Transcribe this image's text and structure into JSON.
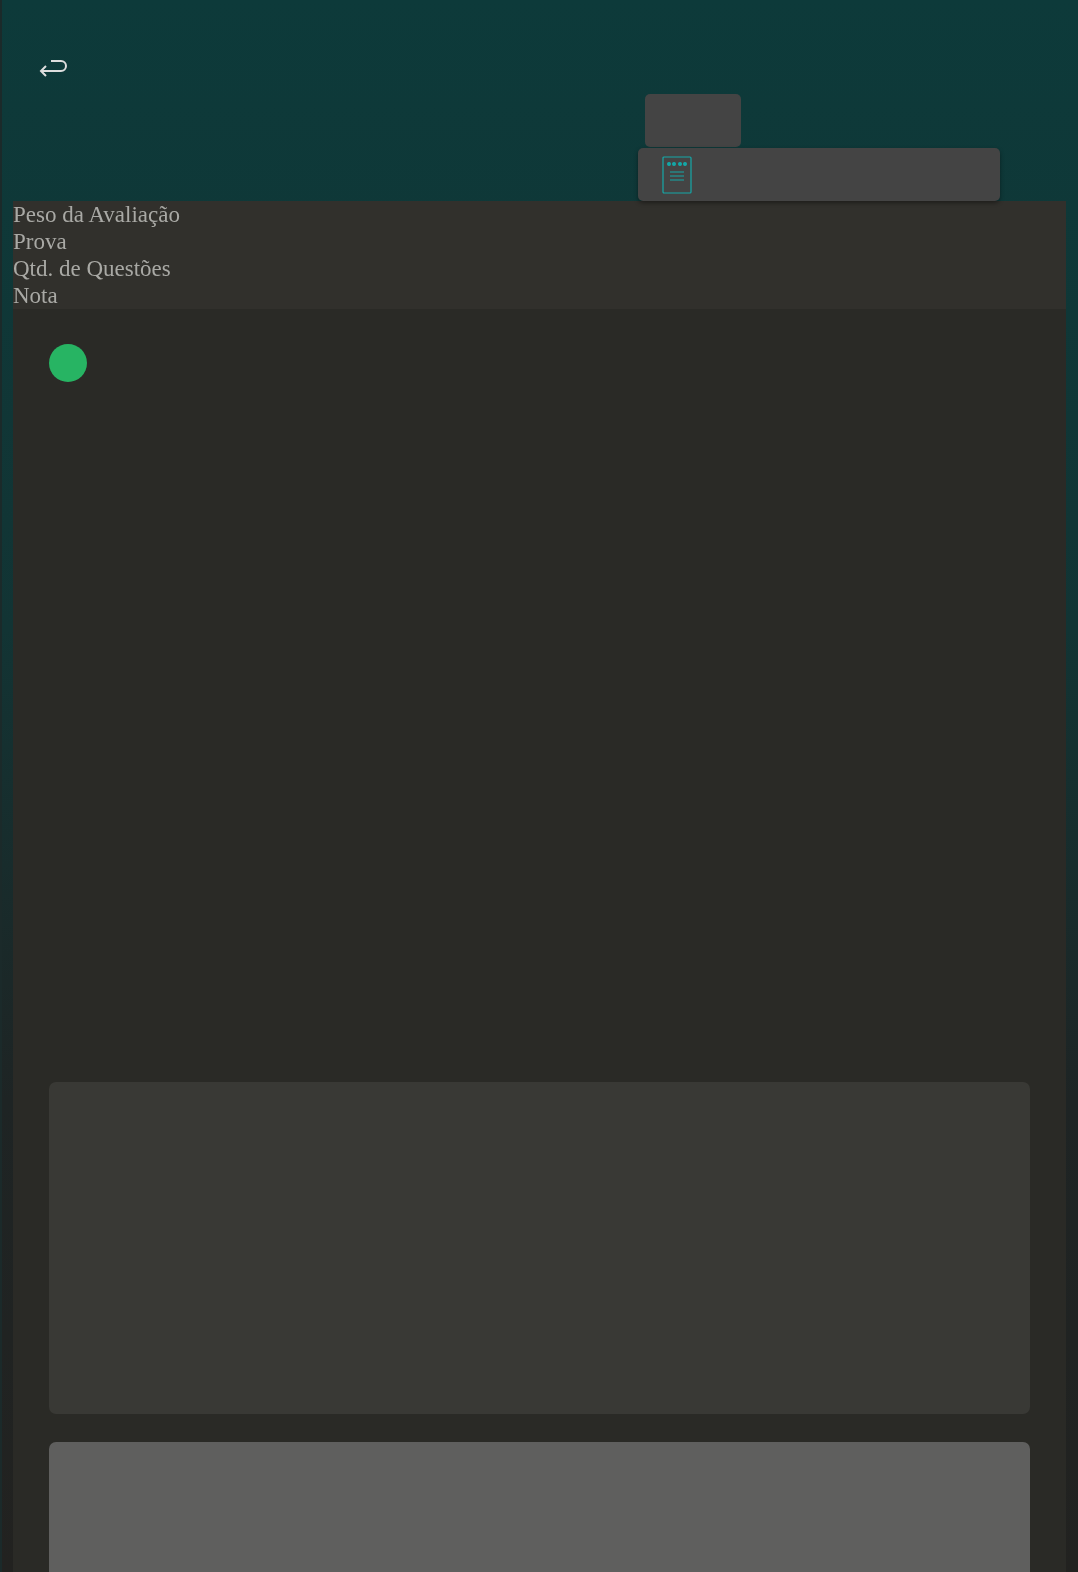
{
  "table": {
    "columns": [
      {
        "label": "Peso da Avaliação"
      },
      {
        "label": "Prova"
      },
      {
        "label": "Qtd. de Questões"
      },
      {
        "label": "Nota"
      }
    ]
  }
}
